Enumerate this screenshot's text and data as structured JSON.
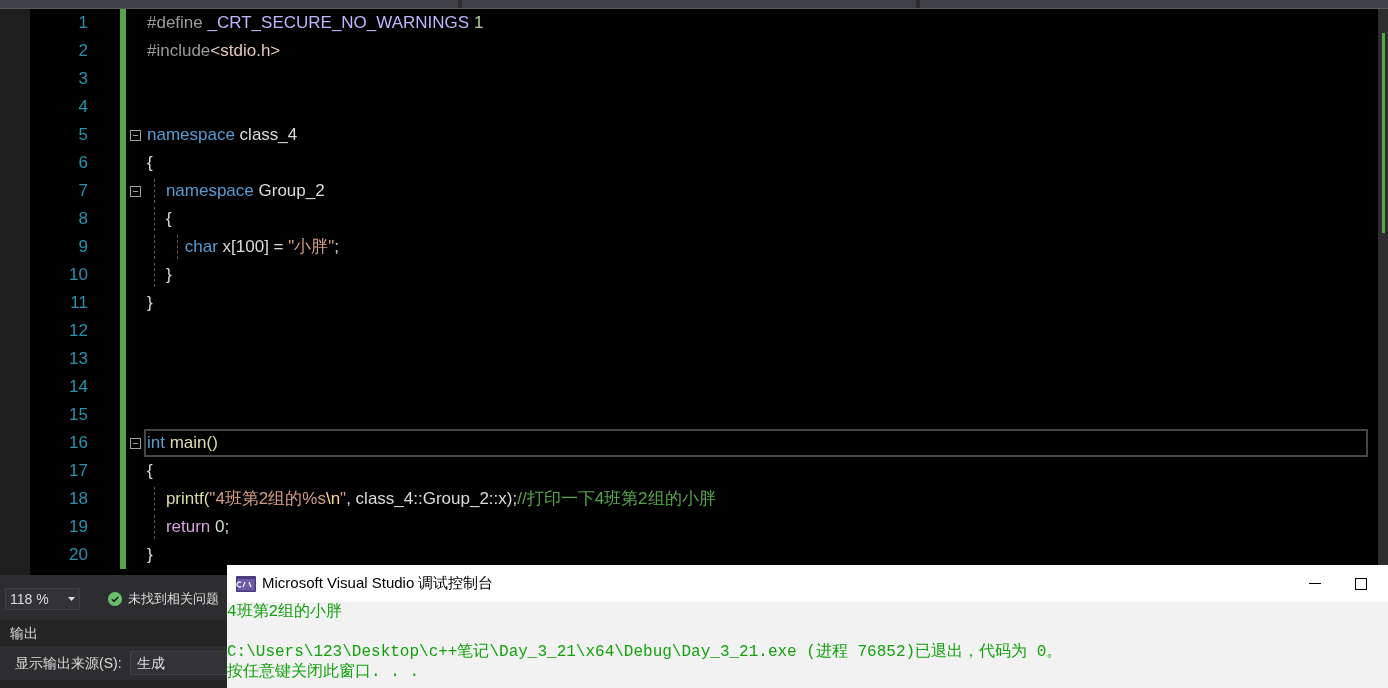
{
  "editor": {
    "lines": [
      {
        "number": "1",
        "current": false,
        "tokens": [
          {
            "text": "#define ",
            "kind": "preproc"
          },
          {
            "text": "_CRT_SECURE_NO_WARNINGS",
            "kind": "macro"
          },
          {
            "text": " 1",
            "kind": "number"
          }
        ]
      },
      {
        "number": "2",
        "current": false,
        "tokens": [
          {
            "text": "#include",
            "kind": "preproc"
          },
          {
            "text": "<stdio.h>",
            "kind": "header"
          }
        ]
      },
      {
        "number": "3",
        "current": false
      },
      {
        "number": "4",
        "current": false
      },
      {
        "number": "5",
        "current": false,
        "expanded": true,
        "tokens": [
          {
            "text": "namespace",
            "kind": "keyword"
          },
          {
            "text": " class_4",
            "kind": "plain"
          }
        ]
      },
      {
        "number": "6",
        "current": false,
        "tokens": [
          {
            "text": "{",
            "kind": "plain"
          }
        ]
      },
      {
        "number": "7",
        "current": false,
        "expanded": true,
        "tokens": [
          {
            "text": "    namespace",
            "kind": "keyword"
          },
          {
            "text": " Group_2",
            "kind": "plain"
          }
        ]
      },
      {
        "number": "8",
        "current": false,
        "tokens": [
          {
            "text": "    {",
            "kind": "plain"
          }
        ]
      },
      {
        "number": "9",
        "current": false,
        "tokens": [
          {
            "text": "        char",
            "kind": "keyword"
          },
          {
            "text": " x[100] = ",
            "kind": "plain"
          },
          {
            "text": "\"小胖\"",
            "kind": "string"
          },
          {
            "text": ";",
            "kind": "plain"
          }
        ]
      },
      {
        "number": "10",
        "current": false,
        "tokens": [
          {
            "text": "    }",
            "kind": "plain"
          }
        ]
      },
      {
        "number": "11",
        "current": false,
        "tokens": [
          {
            "text": "}",
            "kind": "plain"
          }
        ]
      },
      {
        "number": "12",
        "current": false
      },
      {
        "number": "13",
        "current": false
      },
      {
        "number": "14",
        "current": false
      },
      {
        "number": "15",
        "current": false
      },
      {
        "number": "16",
        "current": true,
        "expanded": true,
        "tokens": [
          {
            "text": "int",
            "kind": "keyword"
          },
          {
            "text": " main()",
            "kind": "function"
          }
        ]
      },
      {
        "number": "17",
        "current": false,
        "tokens": [
          {
            "text": "{",
            "kind": "plain"
          }
        ]
      },
      {
        "number": "18",
        "current": false,
        "tokens": [
          {
            "text": "    printf(",
            "kind": "function"
          },
          {
            "text": "\"4班第2组的%s",
            "kind": "string"
          },
          {
            "text": "\\n",
            "kind": "escape"
          },
          {
            "text": "\"",
            "kind": "string"
          },
          {
            "text": ", class_4::Group_2::x);",
            "kind": "plain"
          },
          {
            "text": "//打印一下4班第2组的小胖",
            "kind": "comment"
          }
        ]
      },
      {
        "number": "19",
        "current": false,
        "tokens": [
          {
            "text": "    return",
            "kind": "control"
          },
          {
            "text": " 0;",
            "kind": "plain"
          }
        ]
      },
      {
        "number": "20",
        "current": false,
        "tokens": [
          {
            "text": "}",
            "kind": "plain"
          }
        ]
      }
    ]
  },
  "status_bar": {
    "zoom": "118 %",
    "issues": "未找到相关问题"
  },
  "output_panel": {
    "title": "输出",
    "source_label": "显示输出来源(S):",
    "source_value": "生成"
  },
  "console": {
    "title": "Microsoft Visual Studio 调试控制台",
    "blocks": [
      {
        "lines": [
          "4班第2组的小胖"
        ]
      },
      {
        "lines": [
          "C:\\Users\\123\\Desktop\\c++笔记\\Day_3_21\\x64\\Debug\\Day_3_21.exe (进程 76852)已退出，代码为 0。",
          "按任意键关闭此窗口. . ."
        ]
      }
    ]
  }
}
